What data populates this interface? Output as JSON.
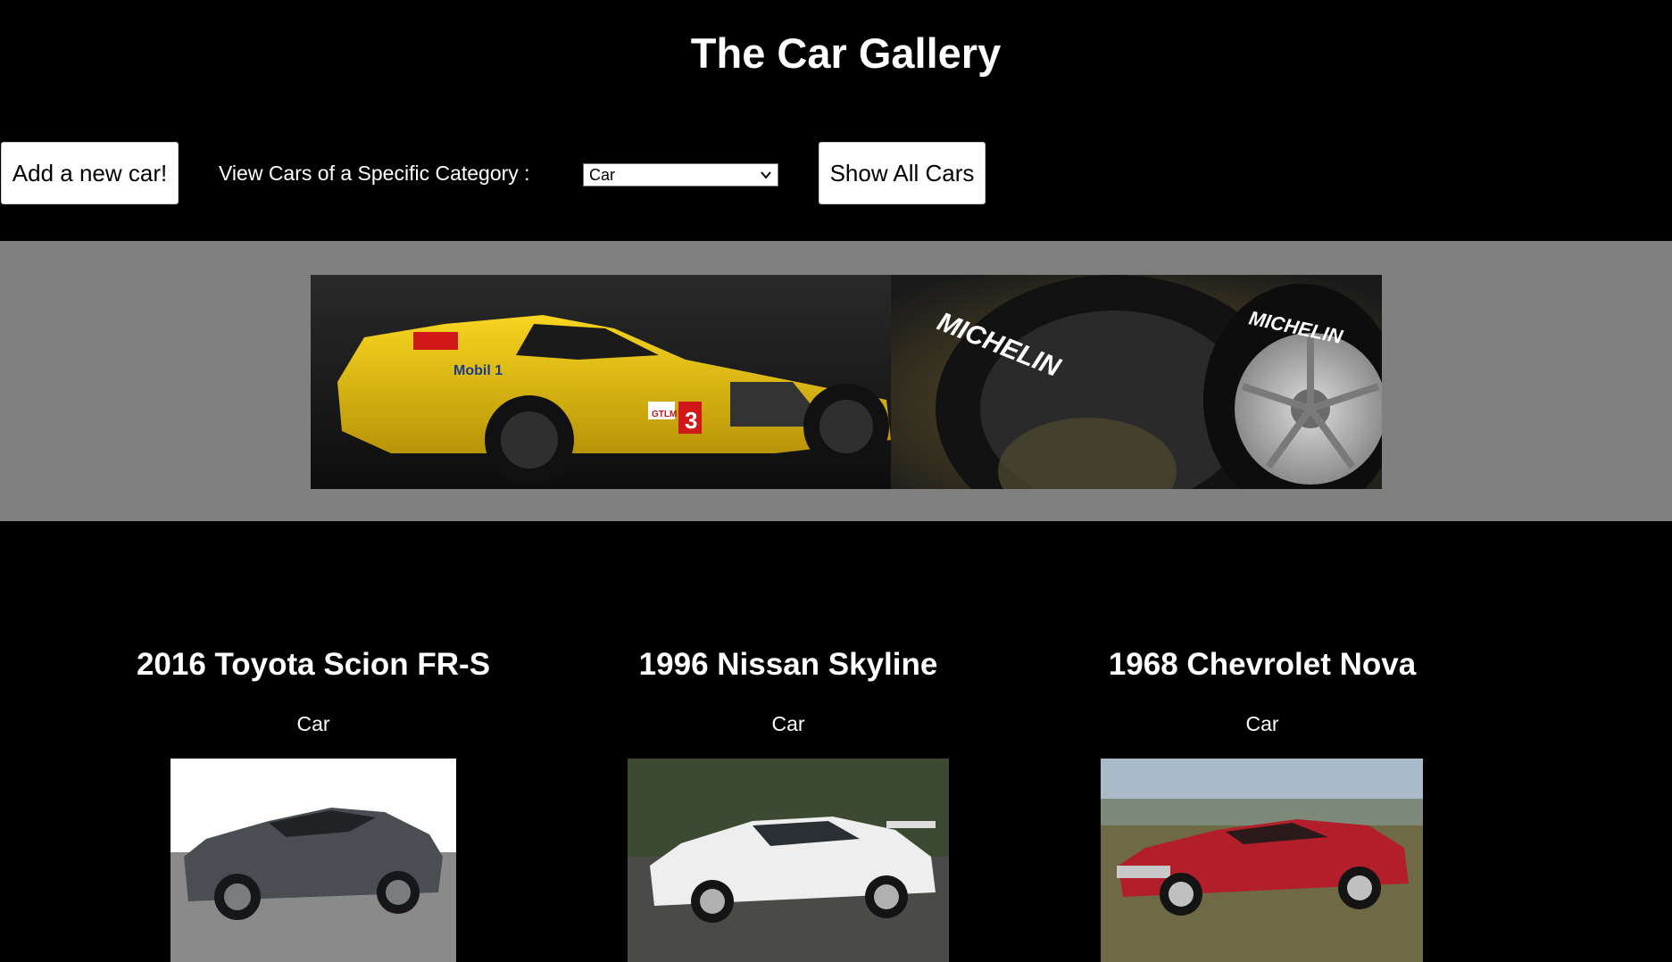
{
  "header": {
    "title": "The Car Gallery"
  },
  "toolbar": {
    "add_label": "Add a new car!",
    "category_label": "View Cars of a Specific Category :",
    "category_selected": "Car",
    "show_all_label": "Show All Cars"
  },
  "banner": {
    "brand_text": "MICHELIN",
    "sponsor_text": "Mobil 1",
    "car_number": "3",
    "car_class": "GTLM"
  },
  "gallery": {
    "cars": [
      {
        "title": "2016 Toyota Scion FR-S",
        "category": "Car"
      },
      {
        "title": "1996 Nissan Skyline",
        "category": "Car"
      },
      {
        "title": "1968 Chevrolet Nova",
        "category": "Car"
      }
    ]
  },
  "colors": {
    "page_background": "#000000",
    "banner_strip": "#808080",
    "button_background": "#ffffff",
    "text": "#ffffff"
  }
}
